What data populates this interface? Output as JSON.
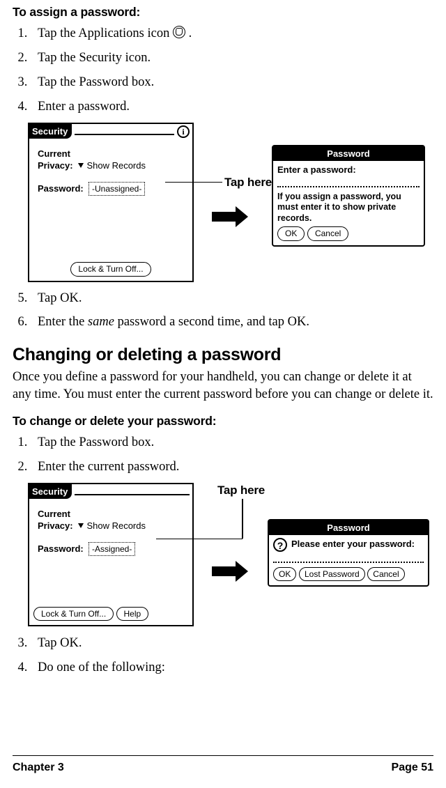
{
  "headings": {
    "assign": "To assign a password:",
    "changeTitle": "Changing or deleting a password",
    "changeSub": "To change or delete your password:"
  },
  "steps_assign": {
    "s1_a": "Tap the Applications icon ",
    "s1_b": ".",
    "s2": "Tap the Security icon.",
    "s3": "Tap the Password box.",
    "s4": "Enter a password.",
    "s5": "Tap OK.",
    "s6_a": "Enter the ",
    "s6_b": "same",
    "s6_c": " password a second time, and tap OK."
  },
  "para_change": "Once you define a password for your handheld, you can change or delete it at any time. You must enter the current password before you can change or delete it.",
  "steps_change": {
    "s1": "Tap the Password box.",
    "s2": "Enter the current password.",
    "s3": "Tap OK.",
    "s4": "Do one of the following:"
  },
  "security_screen": {
    "title": "Security",
    "current": "Current",
    "privacy": "Privacy:",
    "show": "Show Records",
    "password_label": "Password:",
    "unassigned": "-Unassigned-",
    "assigned": "-Assigned-",
    "lock_btn": "Lock & Turn Off...",
    "help_btn": "Help",
    "info_glyph": "i"
  },
  "pw_dialog_assign": {
    "title": "Password",
    "prompt": "Enter a password:",
    "help": "If you assign a password, you must enter it to show private records.",
    "ok": "OK",
    "cancel": "Cancel"
  },
  "pw_dialog_enter": {
    "title": "Password",
    "prompt": "Please enter your password:",
    "ok": "OK",
    "lost": "Lost Password",
    "cancel": "Cancel"
  },
  "callouts": {
    "tap_here": "Tap here"
  },
  "footer": {
    "left": "Chapter 3",
    "right": "Page 51"
  }
}
